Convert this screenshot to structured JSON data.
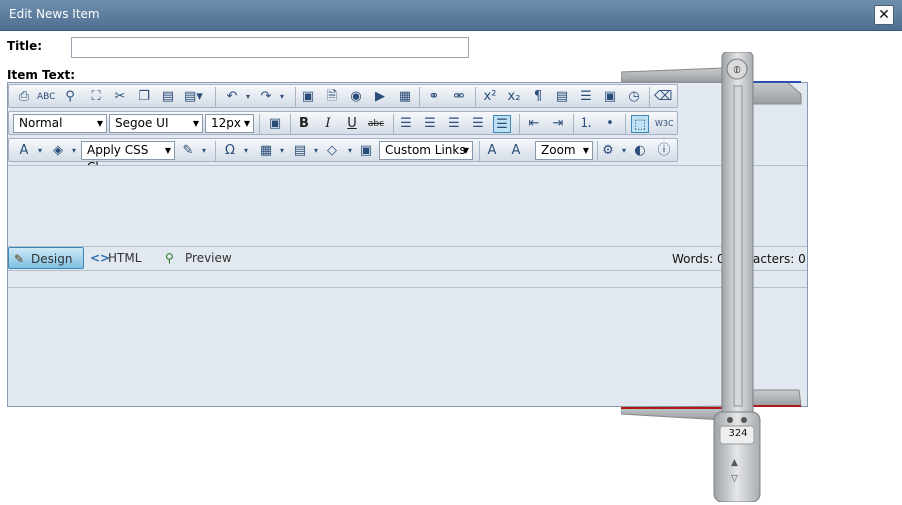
{
  "window": {
    "title": "Edit News Item",
    "close_glyph": "✕"
  },
  "form": {
    "title_label": "Title:",
    "title_value": "",
    "item_text_label": "Item Text:"
  },
  "toolbar": {
    "format_block": "Normal",
    "font_name": "Segoe UI",
    "font_size": "12px",
    "css_class": "Apply CSS Cl...",
    "custom_links": "Custom Links",
    "zoom": "Zoom"
  },
  "modes": {
    "design": "Design",
    "html": "HTML",
    "preview": "Preview"
  },
  "status": {
    "words": "Words: 0",
    "characters": "acters: 0"
  },
  "ruler": {
    "readout": "324"
  },
  "colors": {
    "titlebar": "#5b7ea3",
    "editor_bg": "#e2e8ef",
    "accent": "#3f88b5"
  }
}
